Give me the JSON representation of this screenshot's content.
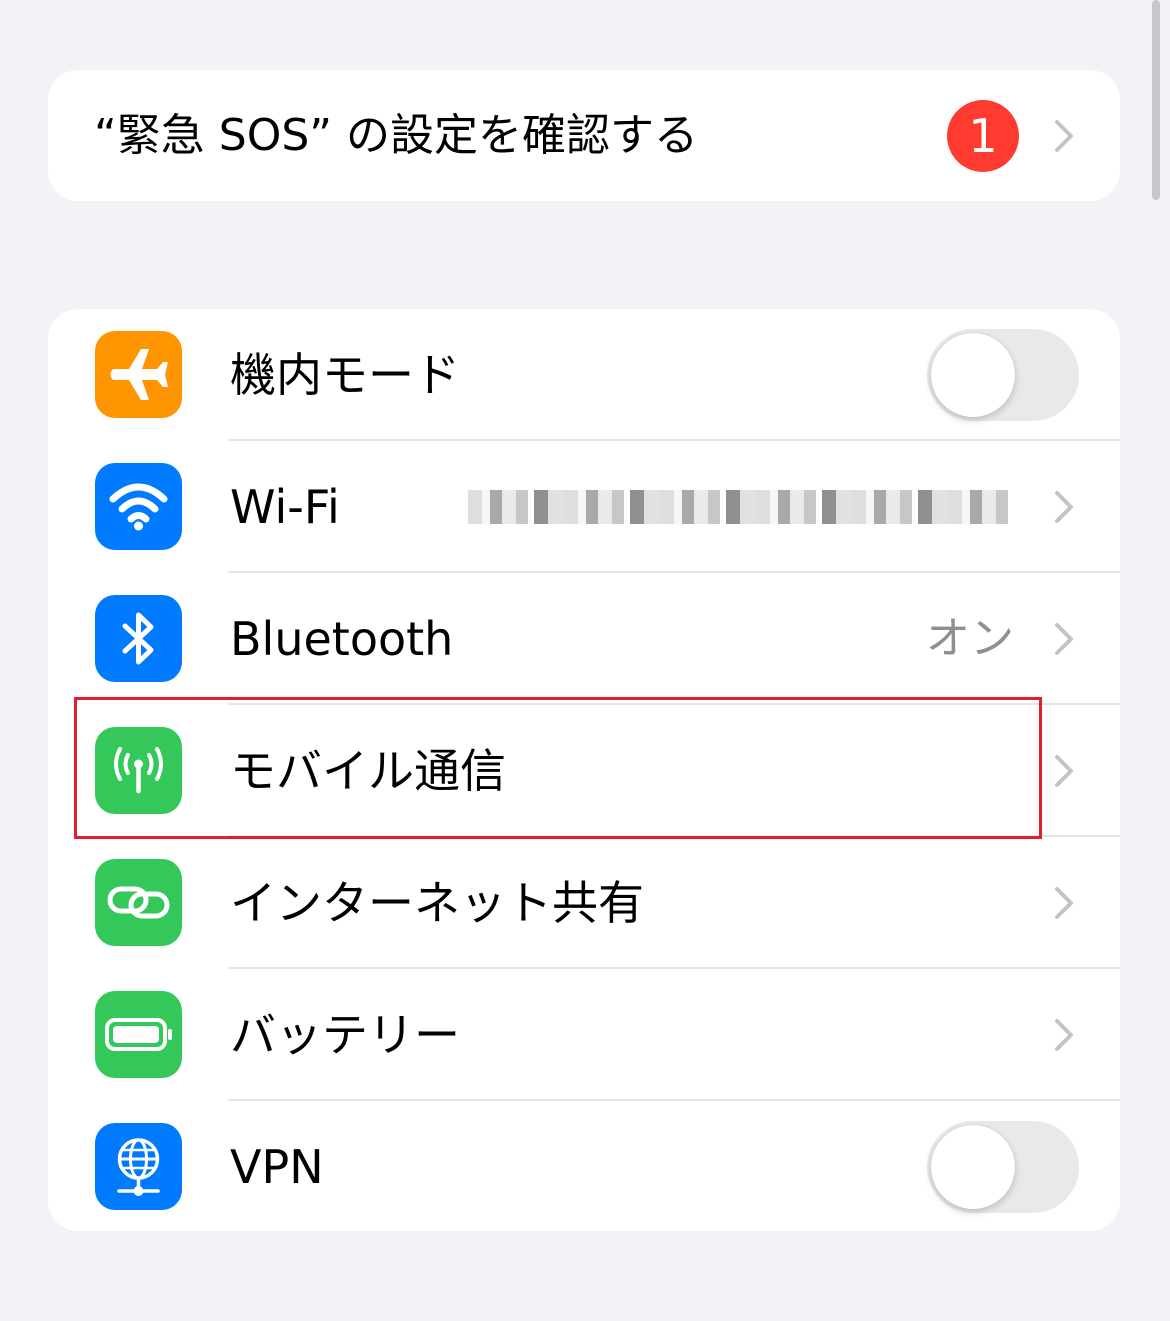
{
  "sos_banner": {
    "title": "“緊急 SOS” の設定を確認する",
    "badge_count": "1"
  },
  "settings": [
    {
      "label": "機内モード",
      "icon": "airplane-icon",
      "color": "#ff9500",
      "control": "toggle",
      "toggle_on": false
    },
    {
      "label": "Wi-Fi",
      "icon": "wifi-icon",
      "color": "#007aff",
      "control": "chevron",
      "value": ""
    },
    {
      "label": "Bluetooth",
      "icon": "bluetooth-icon",
      "color": "#007aff",
      "control": "chevron",
      "value": "オン"
    },
    {
      "label": "モバイル通信",
      "icon": "antenna-icon",
      "color": "#34c759",
      "control": "chevron",
      "value": "",
      "highlighted": true
    },
    {
      "label": "インターネット共有",
      "icon": "link-icon",
      "color": "#34c759",
      "control": "chevron",
      "value": ""
    },
    {
      "label": "バッテリー",
      "icon": "battery-icon",
      "color": "#34c759",
      "control": "chevron",
      "value": ""
    },
    {
      "label": "VPN",
      "icon": "globe-network-icon",
      "color": "#007aff",
      "control": "toggle",
      "toggle_on": false
    }
  ],
  "colors": {
    "background": "#f2f2f7",
    "badge": "#ff3b30",
    "highlight_box": "#e0202a",
    "secondary_text": "#8e8e93"
  }
}
